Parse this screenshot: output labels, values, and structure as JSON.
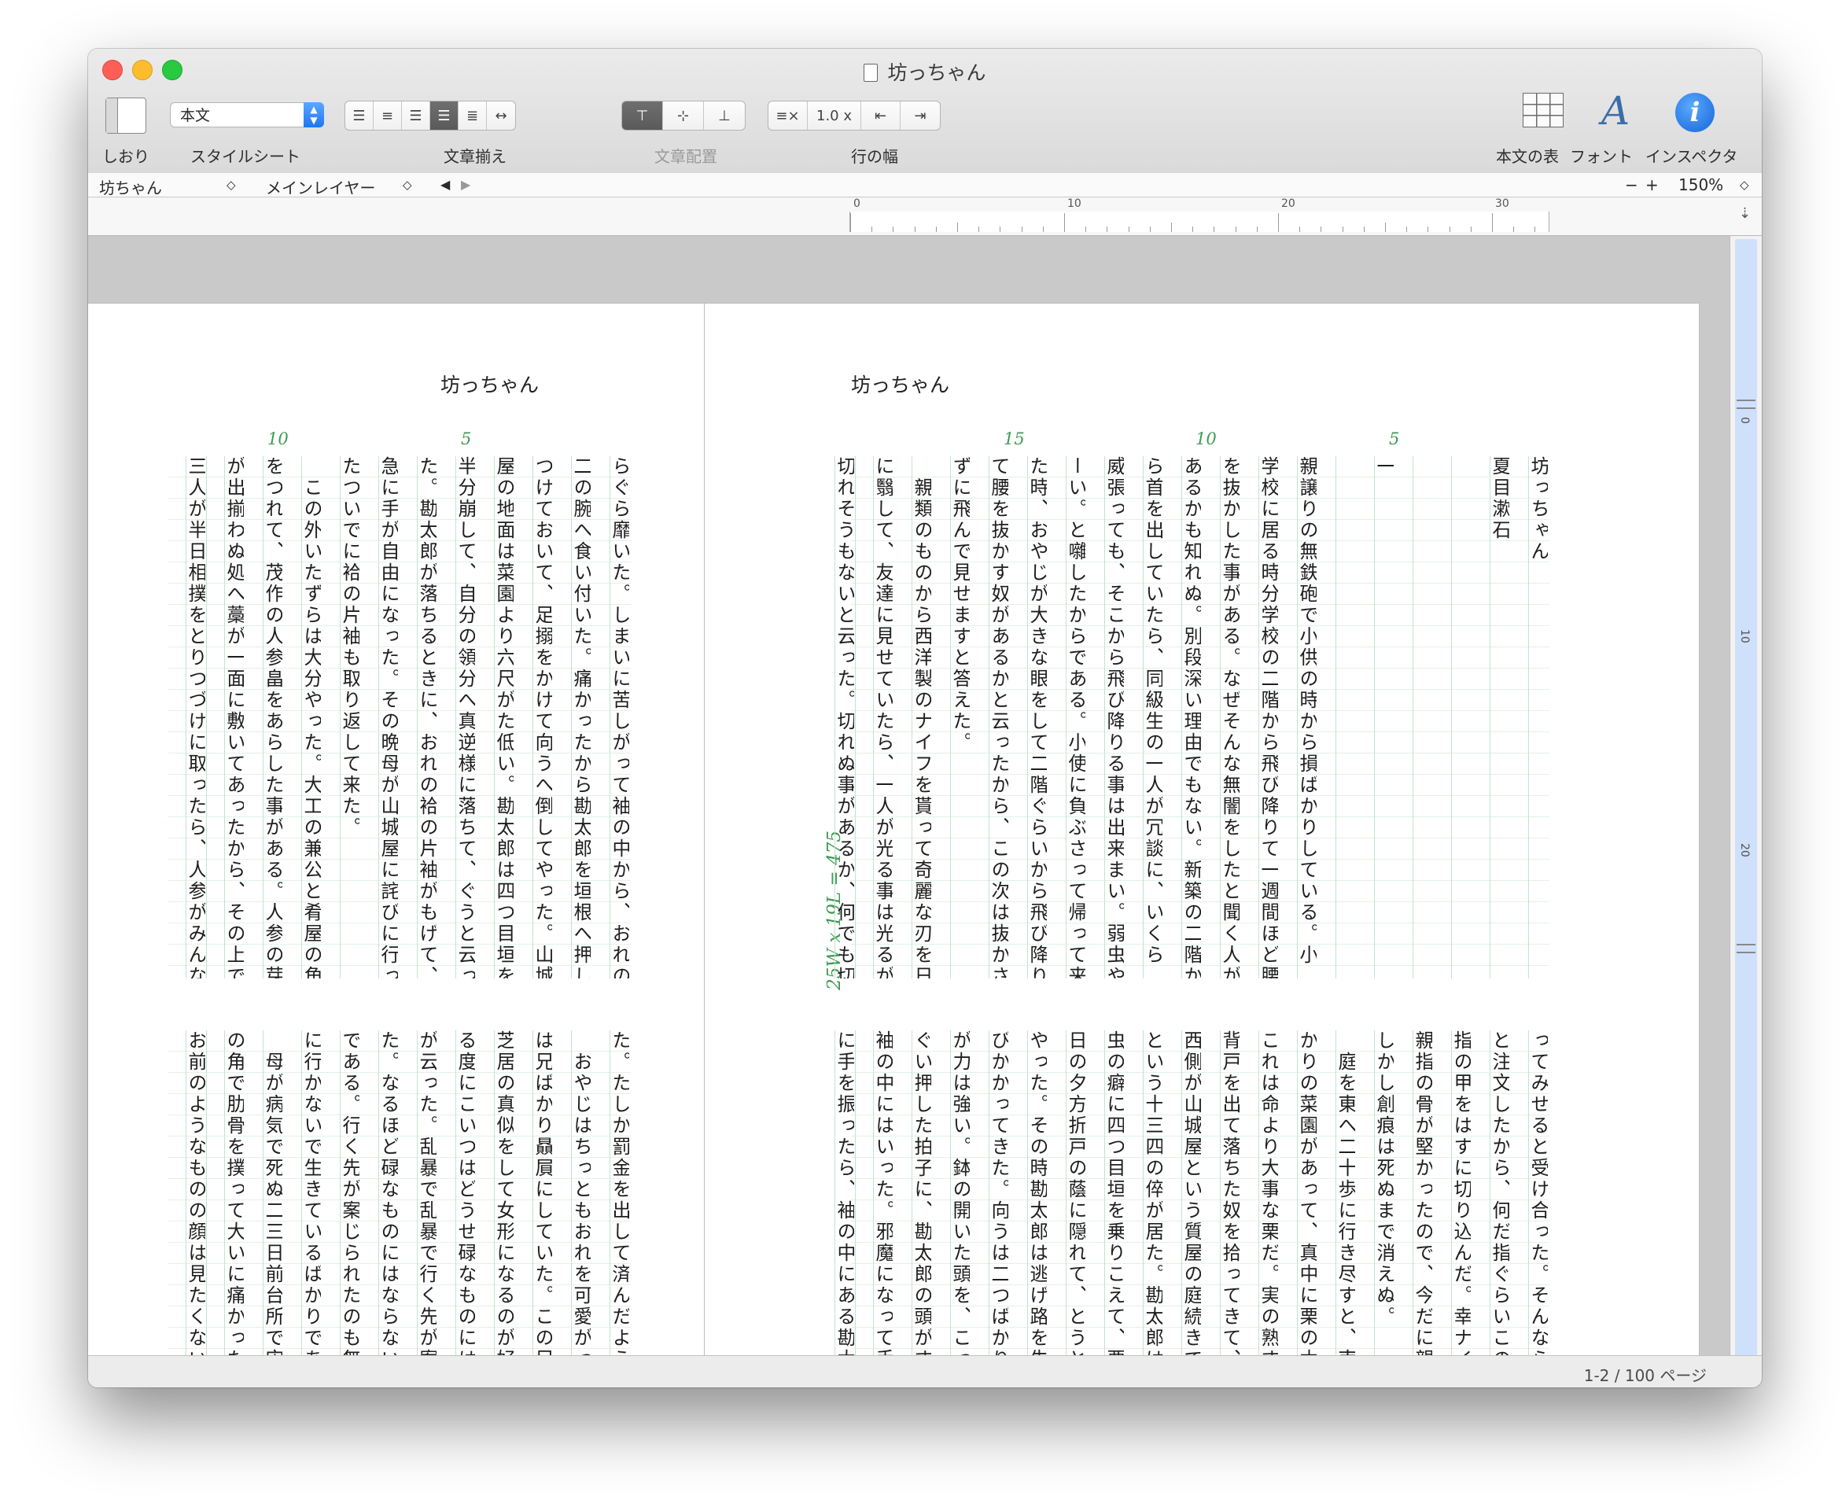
{
  "window": {
    "title": "坊っちゃん"
  },
  "toolbar": {
    "bookmark_label": "しおり",
    "stylesheet_label": "スタイルシート",
    "style_value": "本文",
    "justify_label": "文章揃え",
    "placement_label": "文章配置",
    "line_width_label": "行の幅",
    "line_spacing_value": "1.0 x",
    "table_label": "本文の表",
    "font_label": "フォント",
    "inspector_label": "インスペクタ"
  },
  "navbar": {
    "document": "坊ちゃん",
    "layer": "メインレイヤー",
    "zoom_minus": "−",
    "zoom_plus": "+",
    "zoom": "150%"
  },
  "ruler": {
    "numbers": [
      "0",
      "10",
      "20",
      "30"
    ]
  },
  "vruler": {
    "numbers": [
      "0",
      "10",
      "20"
    ]
  },
  "page_left": {
    "header": "坊っちゃん",
    "line_numbers": [
      "10",
      "5"
    ],
    "top_columns": [
      "らぐら靡いた。しまいに苦しがって袖の中から、おれの",
      "二の腕へ食い付いた。痛かったから勘太郎を垣根へ押し",
      "つけておいて、足搦をかけて向うへ倒してやった。山城",
      "屋の地面は菜園より六尺がた低い。勘太郎は四つ目垣を",
      "半分崩して、自分の領分へ真逆様に落ちて、ぐうと云っ",
      "た。勘太郎が落ちるときに、おれの袷の片袖がもげて、",
      "急に手が自由になった。その晩母が山城屋に詫びに行っ",
      "たついでに袷の片袖も取り返して来た。",
      "　この外いたずらは大分やった。大工の兼公と肴屋の角",
      "をつれて、茂作の人参畠をあらした事がある。人参の芽",
      "が出揃わぬ処へ藁が一面に敷いてあったから、その上で",
      "三人が半日相撲をとりつづけに取ったら、人参がみんな"
    ],
    "bottom_columns": [
      "た。たしか罰金を出して済んだようであ",
      "　おやじはちっともおれを可愛がってく",
      "は兄ばかり贔屓にしていた。この兄はや",
      "芝居の真似をして女形になるのが好きだ",
      "る度にこいつはどうせ碌なものにはなら",
      "が云った。乱暴で乱暴で行く先が案じら",
      "た。なるほど碌なものにはならない。ご",
      "である。行く先が案じられたのも無理は",
      "に行かないで生きているばかりである。",
      "　母が病気で死ぬ二三日前台所で宙返り",
      "の角で肋骨を撲って大いに痛かった。母",
      "お前のようなものの顔は見たくないと云"
    ]
  },
  "page_right": {
    "header": "坊っちゃん",
    "line_numbers": [
      "15",
      "10",
      "5"
    ],
    "char_counter": "25W x 19L = 475",
    "top_columns": [
      "坊っちゃん",
      "夏目漱石",
      "",
      "",
      "一",
      "",
      "親譲りの無鉄砲で小供の時から損ばかりしている。小",
      "学校に居る時分学校の二階から飛び降りて一週間ほど腰",
      "を抜かした事がある。なぜそんな無闇をしたと聞く人が",
      "あるかも知れぬ。別段深い理由でもない。新築の二階か",
      "ら首を出していたら、同級生の一人が冗談に、いくら",
      "威張っても、そこから飛び降りる事は出来まい。弱虫や",
      "ーい。と囃したからである。小使に負ぶさって帰って来",
      "た時、おやじが大きな眼をして二階ぐらいから飛び降り",
      "て腰を抜かす奴があるかと云ったから、この次は抜かさ",
      "ずに飛んで見せますと答えた。",
      "　親類のものから西洋製のナイフを貰って奇麗な刃を日",
      "に翳して、友達に見せていたら、一人が光る事は光るが",
      "切れそうもないと云った。切れぬ事があるか、何でも切"
    ],
    "bottom_columns": [
      "ってみせると受け合った。そんなら君の",
      "と注文したから、何だ指ぐらいこの通り",
      "指の甲をはすに切り込んだ。幸ナイフが",
      "親指の骨が堅かったので、今だに親指は",
      "しかし創痕は死ぬまで消えぬ。",
      "　庭を東へ二十歩に行き尽すと、南上が",
      "かりの菜園があって、真中に栗の木が",
      "これは命より大事な栗だ。実の熟する時",
      "背戸を出て落ちた奴を拾ってきて、学校",
      "西側が山城屋という質屋の庭続きで、こ",
      "という十三四の倅が居た。勘太郎は無論",
      "虫の癖に四つ目垣を乗りこえて、栗を盗",
      "日の夕方折戸の蔭に隠れて、とうとう勘",
      "やった。その時勘太郎は逃げ路を失って",
      "びかかってきた。向うは二つばかり年上",
      "が力は強い。鉢の開いた頭を、こっちの",
      "ぐい押した拍子に、勘太郎の頭がすべっ",
      "袖の中にはいった。邪魔になって手が使",
      "に手を振ったら、袖の中にある勘太郎の"
    ]
  },
  "status": {
    "pages": "1-2 / 100 ページ"
  }
}
